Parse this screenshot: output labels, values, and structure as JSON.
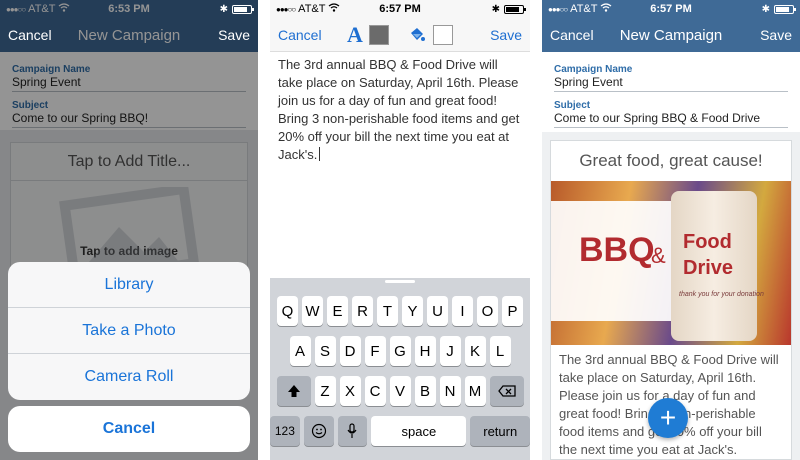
{
  "status": {
    "carrier": "AT&T",
    "time_1": "6:53 PM",
    "time_2": "6:57 PM",
    "time_3": "6:57 PM"
  },
  "nav": {
    "cancel": "Cancel",
    "save": "Save",
    "title": "New Campaign"
  },
  "form": {
    "campaign_name_label": "Campaign Name",
    "campaign_name_value": "Spring Event",
    "subject_label": "Subject",
    "subject_value_1": "Come to our Spring BBQ!",
    "subject_value_3": "Come to our Spring BBQ & Food Drive"
  },
  "screen1": {
    "tap_title": "Tap to Add Title...",
    "tap_image": "Tap to add image",
    "sheet_options": [
      "Library",
      "Take a Photo",
      "Camera Roll"
    ],
    "sheet_cancel": "Cancel"
  },
  "screen2": {
    "font_glyph": "A",
    "body_text": "The 3rd annual BBQ & Food Drive will take place on Saturday, April 16th. Please join us for a day of fun and great food! Bring 3 non-perishable food items and get 20% off your bill the next time you eat at Jack's.",
    "keyboard": {
      "row1": [
        "Q",
        "W",
        "E",
        "R",
        "T",
        "Y",
        "U",
        "I",
        "O",
        "P"
      ],
      "row2": [
        "A",
        "S",
        "D",
        "F",
        "G",
        "H",
        "J",
        "K",
        "L"
      ],
      "row3": [
        "Z",
        "X",
        "C",
        "V",
        "B",
        "N",
        "M"
      ],
      "k123": "123",
      "space": "space",
      "return": "return"
    }
  },
  "screen3": {
    "headline": "Great food, great cause!",
    "hero_bbq": "BBQ",
    "hero_amp": "&",
    "hero_food": "Food",
    "hero_drive": "Drive",
    "hero_tag": "thank you for your donation",
    "body_text": "The 3rd annual BBQ & Food Drive will take place on Saturday, April 16th. Please join us for a day of fun and great food! Bring 3 non-perishable food items and get 20% off your bill the next time you eat at Jack's."
  },
  "icons": {
    "fab": "plus-icon",
    "shift": "shift-icon",
    "backspace": "backspace-icon",
    "emoji": "emoji-icon",
    "mic": "microphone-icon",
    "bucket": "paint-bucket-icon",
    "wifi": "wifi-icon",
    "bluetooth": "bluetooth-icon",
    "battery": "battery-icon"
  },
  "colors": {
    "nav_blue": "#3f6a96",
    "link_blue": "#1f6fd1",
    "fab_blue": "#1f7cd4",
    "swatch_text": "#6b6b6b",
    "swatch_fill": "#ffffff"
  }
}
